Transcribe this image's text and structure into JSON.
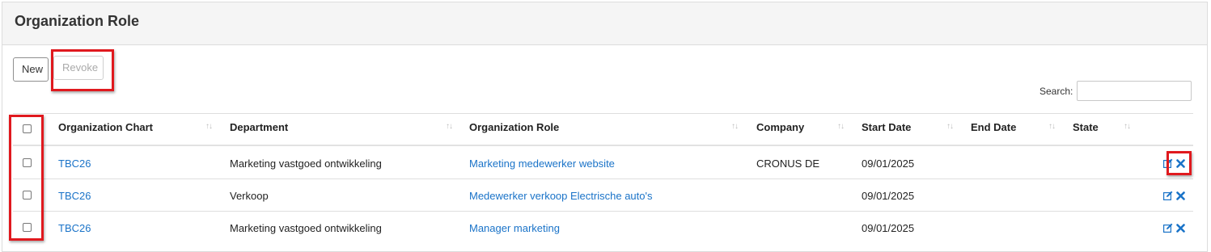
{
  "panel": {
    "title": "Organization Role"
  },
  "toolbar": {
    "new_label": "New",
    "revoke_label": "Revoke"
  },
  "search": {
    "label": "Search:",
    "value": ""
  },
  "table": {
    "columns": [
      "Organization Chart",
      "Department",
      "Organization Role",
      "Company",
      "Start Date",
      "End Date",
      "State"
    ],
    "sort_glyph": "↑↓",
    "rows": [
      {
        "organization_chart": "TBC26",
        "department": "Marketing vastgoed ontwikkeling",
        "organization_role": "Marketing medewerker website",
        "company": "CRONUS DE",
        "start_date": "09/01/2025",
        "end_date": "",
        "state": ""
      },
      {
        "organization_chart": "TBC26",
        "department": "Verkoop",
        "organization_role": "Medewerker verkoop Electrische auto's",
        "company": "",
        "start_date": "09/01/2025",
        "end_date": "",
        "state": ""
      },
      {
        "organization_chart": "TBC26",
        "department": "Marketing vastgoed ontwikkeling",
        "organization_role": "Manager marketing",
        "company": "",
        "start_date": "09/01/2025",
        "end_date": "",
        "state": ""
      }
    ]
  },
  "colors": {
    "link": "#1a73c8",
    "highlight": "#e0191e",
    "header_bg": "#f5f5f5"
  },
  "icons": {
    "edit": "edit-icon",
    "delete": "close-icon"
  }
}
